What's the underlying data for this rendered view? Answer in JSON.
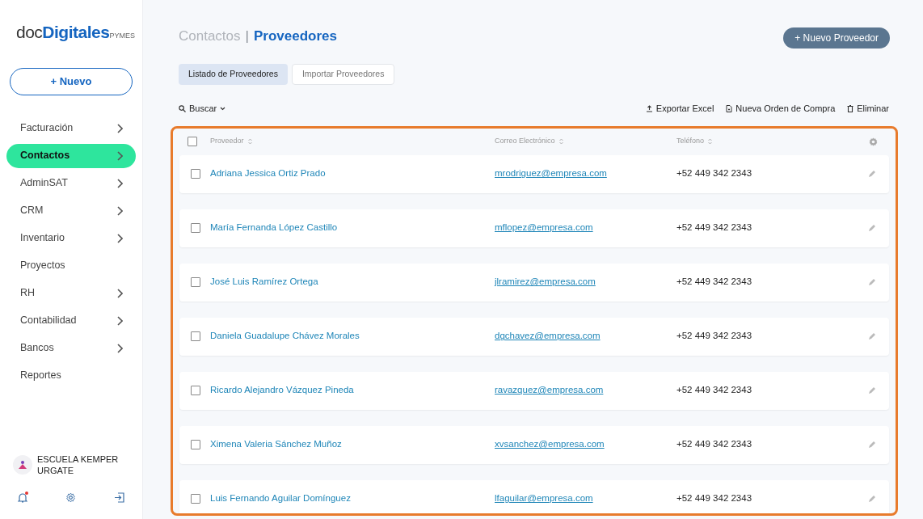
{
  "sidebar": {
    "logo": {
      "prefix": "doc",
      "main": "Digitales",
      "suffix": "PYMES"
    },
    "new_button": "+ Nuevo",
    "items": [
      {
        "label": "Facturación",
        "expandable": true,
        "selected": false
      },
      {
        "label": "Contactos",
        "expandable": true,
        "selected": true
      },
      {
        "label": "AdminSAT",
        "expandable": true,
        "selected": false
      },
      {
        "label": "CRM",
        "expandable": true,
        "selected": false
      },
      {
        "label": "Inventario",
        "expandable": true,
        "selected": false
      },
      {
        "label": "Proyectos",
        "expandable": false,
        "selected": false
      },
      {
        "label": "RH",
        "expandable": true,
        "selected": false
      },
      {
        "label": "Contabilidad",
        "expandable": true,
        "selected": false
      },
      {
        "label": "Bancos",
        "expandable": true,
        "selected": false
      },
      {
        "label": "Reportes",
        "expandable": false,
        "selected": false
      }
    ],
    "account": {
      "name": "ESCUELA KEMPER URGATE"
    },
    "notifications": {
      "unread": true
    }
  },
  "header": {
    "section": "Contactos",
    "separator": "|",
    "title": "Proveedores",
    "new_button": "+ Nuevo Proveedor"
  },
  "tabs": [
    {
      "label": "Listado de Proveedores",
      "selected": true
    },
    {
      "label": "Importar Proveedores",
      "selected": false
    }
  ],
  "toolbar": {
    "search": "Buscar",
    "actions": [
      {
        "kind": "export",
        "label": "Exportar Excel"
      },
      {
        "kind": "order",
        "label": "Nueva Orden de Compra"
      },
      {
        "kind": "delete",
        "label": "Eliminar"
      }
    ]
  },
  "table": {
    "select_all_checked": false,
    "columns": [
      "Proveedor",
      "Correo Electrónico",
      "Teléfono"
    ],
    "rows": [
      {
        "name": "Adriana Jessica Ortiz Prado",
        "email": "mrodriguez@empresa.com",
        "phone": "+52 449 342 2343",
        "checked": false
      },
      {
        "name": "María Fernanda López Castillo",
        "email": "mflopez@empresa.com",
        "phone": "+52 449 342 2343",
        "checked": false
      },
      {
        "name": "José Luis Ramírez Ortega",
        "email": "jlramirez@empresa.com",
        "phone": "+52 449 342 2343",
        "checked": false
      },
      {
        "name": "Daniela Guadalupe Chávez Morales",
        "email": "dgchavez@empresa.com",
        "phone": "+52 449 342 2343",
        "checked": false
      },
      {
        "name": "Ricardo Alejandro Vázquez Pineda",
        "email": "ravazquez@empresa.com",
        "phone": "+52 449 342 2343",
        "checked": false
      },
      {
        "name": "Ximena Valeria Sánchez Muñoz",
        "email": "xvsanchez@empresa.com",
        "phone": "+52 449 342 2343",
        "checked": false
      },
      {
        "name": "Luis Fernando Aguilar Domínguez",
        "email": "lfaguilar@empresa.com",
        "phone": "+52 449 342 2343",
        "checked": false
      }
    ]
  }
}
